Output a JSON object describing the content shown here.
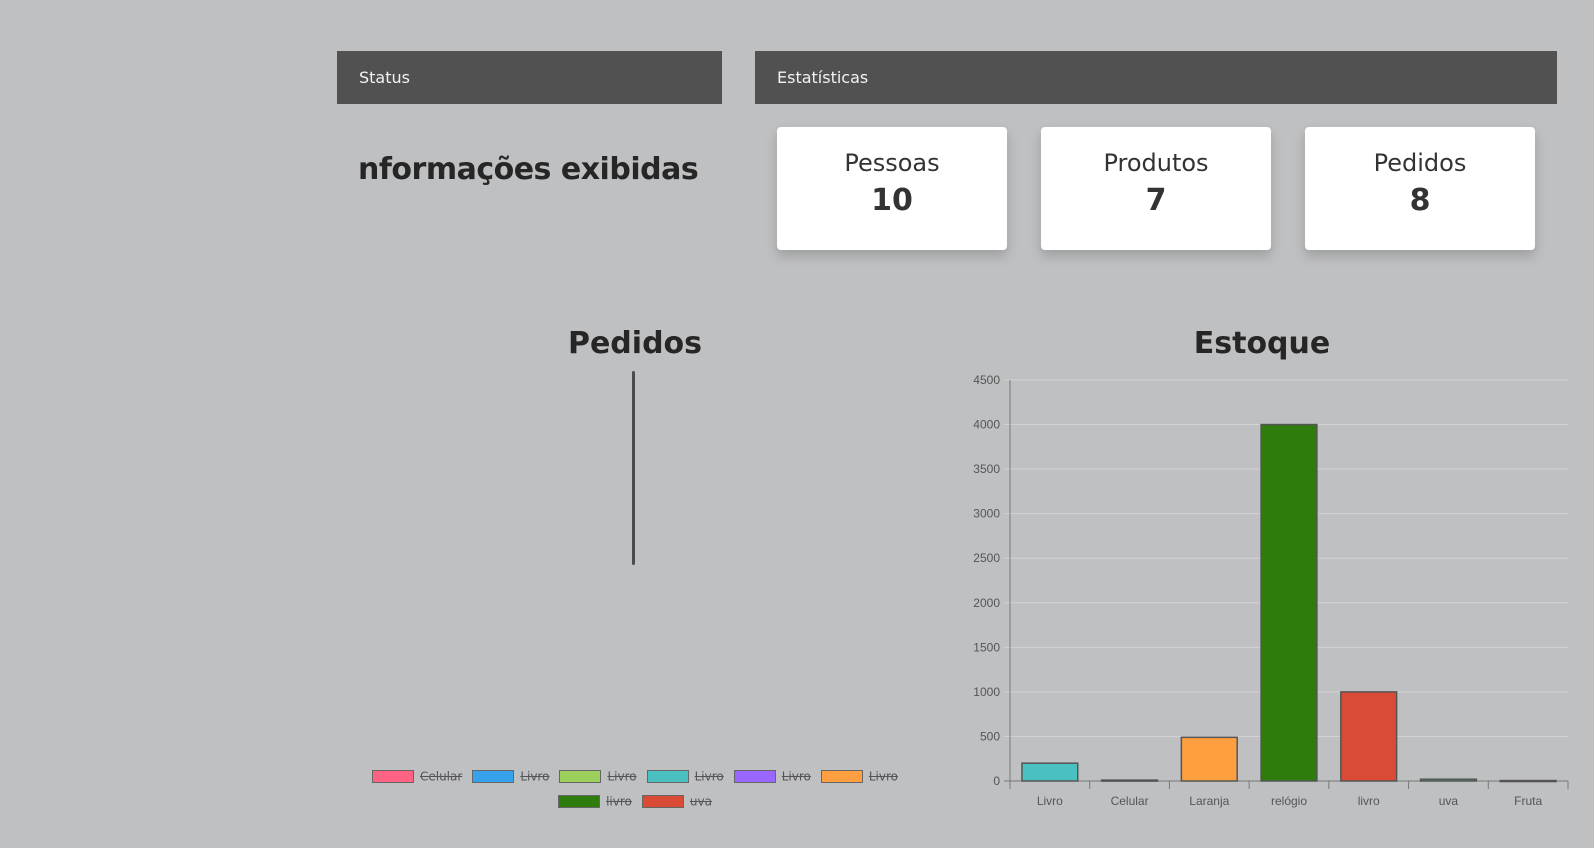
{
  "status_panel": {
    "title": "Status",
    "info_text": "nformações exibidas"
  },
  "stats_panel": {
    "title": "Estatísticas",
    "cards": [
      {
        "label": "Pessoas",
        "value": "10"
      },
      {
        "label": "Produtos",
        "value": "7"
      },
      {
        "label": "Pedidos",
        "value": "8"
      }
    ]
  },
  "chart_data": [
    {
      "type": "pie",
      "title": "Pedidos",
      "legend": [
        {
          "label": "Celular",
          "color": "#ff6384"
        },
        {
          "label": "Livro",
          "color": "#36a2eb"
        },
        {
          "label": "Livro",
          "color": "#9ccf5b"
        },
        {
          "label": "Livro",
          "color": "#4bc0c0"
        },
        {
          "label": "Livro",
          "color": "#9966ff"
        },
        {
          "label": "Livro",
          "color": "#ff9f40"
        },
        {
          "label": "livro",
          "color": "#2e7d0c"
        },
        {
          "label": "uva",
          "color": "#d94b35"
        }
      ],
      "legend_position": "bottom",
      "all_series_hidden": true
    },
    {
      "type": "bar",
      "title": "Estoque",
      "categories": [
        "Livro",
        "Celular",
        "Laranja",
        "relógio",
        "livro",
        "uva",
        "Fruta"
      ],
      "values": [
        200,
        10,
        490,
        4000,
        1000,
        20,
        5
      ],
      "colors": [
        "#4bc0c0",
        "#9966ff",
        "#ff9f40",
        "#2e7d0c",
        "#d94b35",
        "#3cb371",
        "#9ccf5b"
      ],
      "yticks": [
        "0",
        "500",
        "1000",
        "1500",
        "2000",
        "2500",
        "3000",
        "3500",
        "4000",
        "4500"
      ],
      "ylim": [
        0,
        4500
      ],
      "grid": true
    }
  ]
}
